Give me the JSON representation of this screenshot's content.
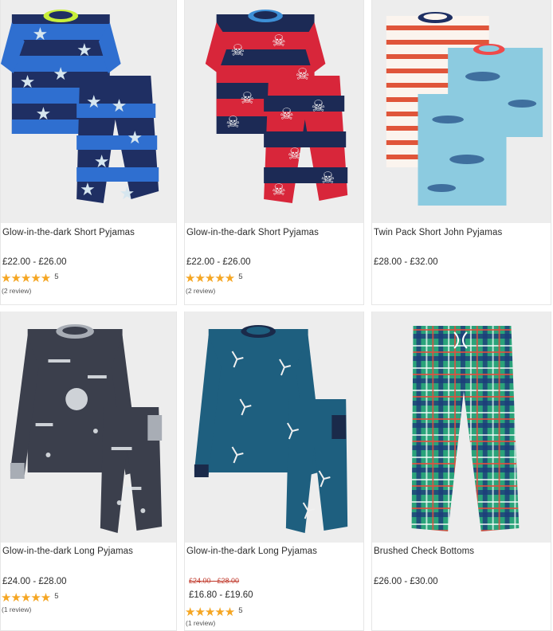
{
  "products": [
    {
      "title": "Glow-in-the-dark Short Pyjamas",
      "price": "£22.00 - £26.00",
      "stars": "★★★★★",
      "score": "5",
      "reviews": "(2 review)",
      "image": "navy-blue-star-pyjamas"
    },
    {
      "title": "Glow-in-the-dark Short Pyjamas",
      "price": "£22.00 - £26.00",
      "stars": "★★★★★",
      "score": "5",
      "reviews": "(2 review)",
      "image": "red-navy-skull-pyjamas"
    },
    {
      "title": "Twin Pack Short John Pyjamas",
      "price": "£28.00 - £32.00",
      "image": "striped-and-shark-pyjamas"
    },
    {
      "title": "Glow-in-the-dark Long Pyjamas",
      "price": "£24.00 - £28.00",
      "stars": "★★★★★",
      "score": "5",
      "reviews": "(1 review)",
      "image": "grey-space-pyjamas"
    },
    {
      "title": "Glow-in-the-dark Long Pyjamas",
      "was_price": "£24.00 - £28.00",
      "price": "£16.80 - £19.60",
      "stars": "★★★★★",
      "score": "5",
      "reviews": "(1 review)",
      "image": "blue-skeleton-pyjamas"
    },
    {
      "title": "Brushed Check Bottoms",
      "price": "£26.00 - £30.00",
      "image": "green-check-bottoms"
    }
  ],
  "colors": {
    "star": "#f5a623",
    "sale": "#c0392b",
    "text": "#2b2b2b"
  }
}
